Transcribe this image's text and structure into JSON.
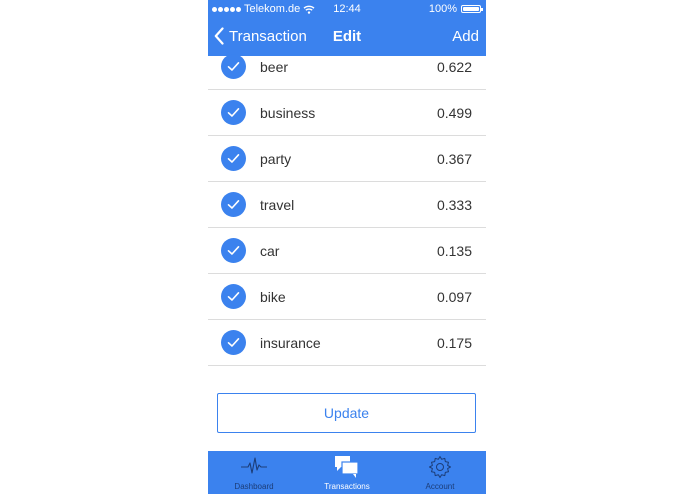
{
  "status_bar": {
    "carrier": "Telekom.de",
    "time": "12:44",
    "battery": "100%"
  },
  "nav": {
    "back_label": "Transaction",
    "title": "Edit",
    "add_label": "Add"
  },
  "items": [
    {
      "label": "beer",
      "value": "0.622"
    },
    {
      "label": "business",
      "value": "0.499"
    },
    {
      "label": "party",
      "value": "0.367"
    },
    {
      "label": "travel",
      "value": "0.333"
    },
    {
      "label": "car",
      "value": "0.135"
    },
    {
      "label": "bike",
      "value": "0.097"
    },
    {
      "label": "insurance",
      "value": "0.175"
    }
  ],
  "update_label": "Update",
  "tabs": [
    {
      "label": "Dashboard",
      "icon": "pulse-icon"
    },
    {
      "label": "Transactions",
      "icon": "chat-bubbles-icon",
      "active": true
    },
    {
      "label": "Account",
      "icon": "gear-icon"
    }
  ],
  "colors": {
    "accent": "#3b82ee",
    "tab_inactive": "#1c3d78"
  }
}
